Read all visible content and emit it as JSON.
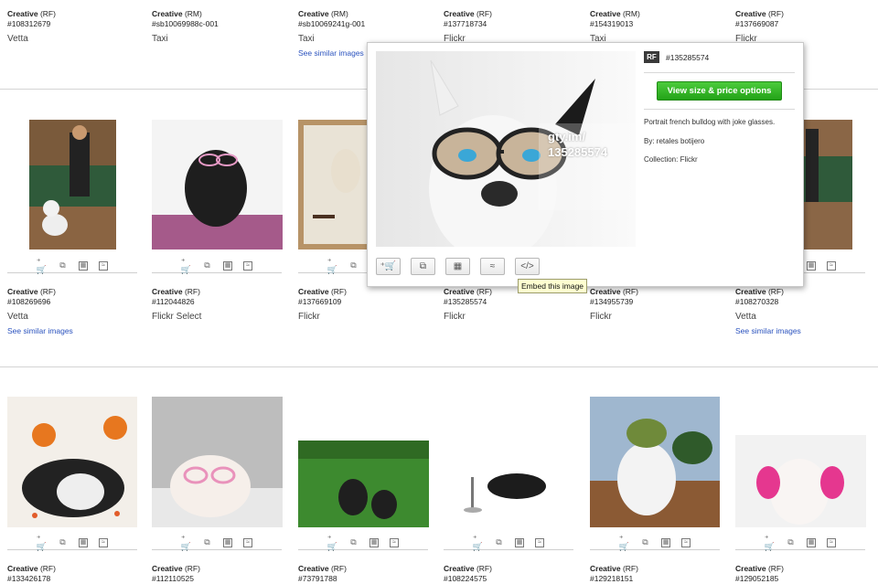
{
  "row1": [
    {
      "license": "Creative",
      "rights": "(RF)",
      "id": "#108312679",
      "collection": "Vetta",
      "similar": ""
    },
    {
      "license": "Creative",
      "rights": "(RM)",
      "id": "#sb10069988c-001",
      "collection": "Taxi",
      "similar": ""
    },
    {
      "license": "Creative",
      "rights": "(RM)",
      "id": "#sb10069241g-001",
      "collection": "Taxi",
      "similar": "See similar images"
    },
    {
      "license": "Creative",
      "rights": "(RF)",
      "id": "#137718734",
      "collection": "Flickr",
      "similar": ""
    },
    {
      "license": "Creative",
      "rights": "(RM)",
      "id": "#154319013",
      "collection": "Taxi",
      "similar": ""
    },
    {
      "license": "Creative",
      "rights": "(RF)",
      "id": "#137669087",
      "collection": "Flickr",
      "similar": ""
    }
  ],
  "row2": [
    {
      "license": "Creative",
      "rights": "(RF)",
      "id": "#108269696",
      "collection": "Vetta",
      "similar": "See similar images"
    },
    {
      "license": "Creative",
      "rights": "(RF)",
      "id": "#112044826",
      "collection": "Flickr Select",
      "similar": ""
    },
    {
      "license": "Creative",
      "rights": "(RF)",
      "id": "#137669109",
      "collection": "Flickr",
      "similar": ""
    },
    {
      "license": "Creative",
      "rights": "(RF)",
      "id": "#135285574",
      "collection": "Flickr",
      "similar": ""
    },
    {
      "license": "Creative",
      "rights": "(RF)",
      "id": "#134955739",
      "collection": "Flickr",
      "similar": ""
    },
    {
      "license": "Creative",
      "rights": "(RF)",
      "id": "#108270328",
      "collection": "Vetta",
      "similar": "See similar images"
    }
  ],
  "row3": [
    {
      "license": "Creative",
      "rights": "(RF)",
      "id": "#133426178"
    },
    {
      "license": "Creative",
      "rights": "(RF)",
      "id": "#112110525"
    },
    {
      "license": "Creative",
      "rights": "(RF)",
      "id": "#73791788"
    },
    {
      "license": "Creative",
      "rights": "(RF)",
      "id": "#108224575"
    },
    {
      "license": "Creative",
      "rights": "(RF)",
      "id": "#129218151"
    },
    {
      "license": "Creative",
      "rights": "(RF)",
      "id": "#129052185"
    }
  ],
  "icons": {
    "cart": "add-to-cart-icon",
    "lightbox": "lightbox-icon",
    "calc": "price-calculator-icon",
    "similar": "similar-icon",
    "embed": "embed-icon"
  },
  "popover": {
    "badge": "RF",
    "id": "#135285574",
    "button": "View size & price options",
    "url_line1": "gty.im/",
    "url_line2": "135285574",
    "caption": "Portrait french bulldog with joke glasses.",
    "by": "By: retales botijero",
    "collection": "Collection: Flickr",
    "embed_tooltip": "Embed this image"
  },
  "colors": {
    "accent_green": "#2fb824",
    "link_blue": "#2a52be"
  }
}
